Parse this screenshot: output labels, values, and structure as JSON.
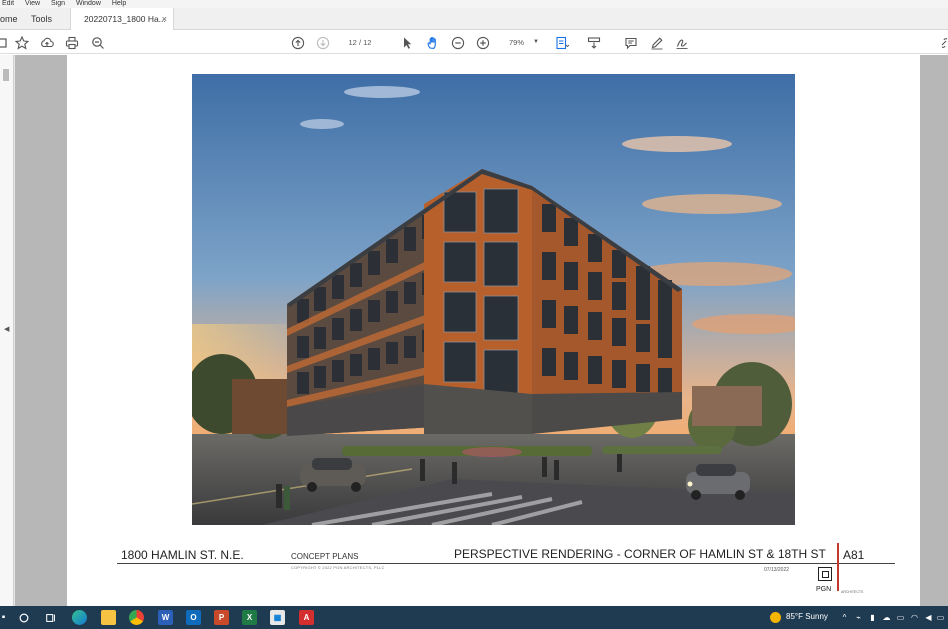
{
  "menu": [
    "Edit",
    "View",
    "Sign",
    "Window",
    "Help"
  ],
  "tabs": {
    "home": "ome",
    "tools": "Tools",
    "document": "20220713_1800 Ha...",
    "close": "×"
  },
  "toolbar": {
    "page_current": "12",
    "page_total": "12",
    "page_separator": "/",
    "zoom": "79%",
    "icons": [
      "bookmark-star-icon",
      "cloud-upload-icon",
      "print-icon",
      "zoom-out-magnifier-icon",
      "page-up-icon",
      "page-down-icon",
      "select-cursor-icon",
      "hand-tool-icon",
      "zoom-out-icon",
      "zoom-in-icon",
      "fit-page-icon",
      "scroll-mode-icon",
      "comment-icon",
      "pen-icon",
      "sign-icon"
    ]
  },
  "sheet": {
    "address": "1800 HAMLIN ST. N.E.",
    "concept": "CONCEPT PLANS",
    "copyright": "COPYRIGHT © 2022 PGN ARCHITECTS, PLLC",
    "title": "PERSPECTIVE RENDERING - CORNER OF HAMLIN ST & 18TH ST",
    "sheet_number": "A81",
    "date": "07/13/2022",
    "firm": "PGN",
    "firm_small": "ARCHITECTS"
  },
  "taskbar": {
    "apps": [
      "windows-start-icon",
      "search-circle-icon",
      "task-view-icon",
      "edge-icon",
      "file-explorer-icon",
      "chrome-icon",
      "word-icon",
      "outlook-icon",
      "powerpoint-icon",
      "excel-icon",
      "store-icon",
      "acrobat-icon"
    ],
    "weather": "85°F  Sunny"
  },
  "colors": {
    "taskbar": "#1f3b52",
    "accent_red": "#c0392b",
    "sky_top": "#3e6ea6",
    "sky_bottom": "#f2a866"
  }
}
